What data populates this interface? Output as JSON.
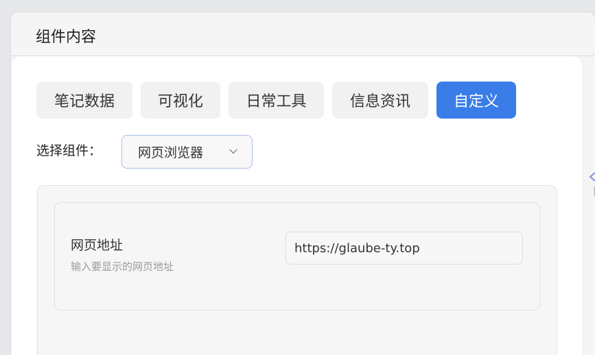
{
  "window": {
    "title": "组件内容"
  },
  "tabs": [
    {
      "label": "笔记数据",
      "active": false
    },
    {
      "label": "可视化",
      "active": false
    },
    {
      "label": "日常工具",
      "active": false
    },
    {
      "label": "信息资讯",
      "active": false
    },
    {
      "label": "自定义",
      "active": true
    }
  ],
  "component_select": {
    "label": "选择组件：",
    "value": "网页浏览器"
  },
  "settings": {
    "url_field": {
      "label": "网页地址",
      "hint": "输入要显示的网页地址",
      "value": "https://glaube-ty.top"
    }
  },
  "colors": {
    "accent": "#3a7de9",
    "select_border": "#a9bce8"
  },
  "icons": {
    "select_arrow": "chevron-down-icon"
  }
}
